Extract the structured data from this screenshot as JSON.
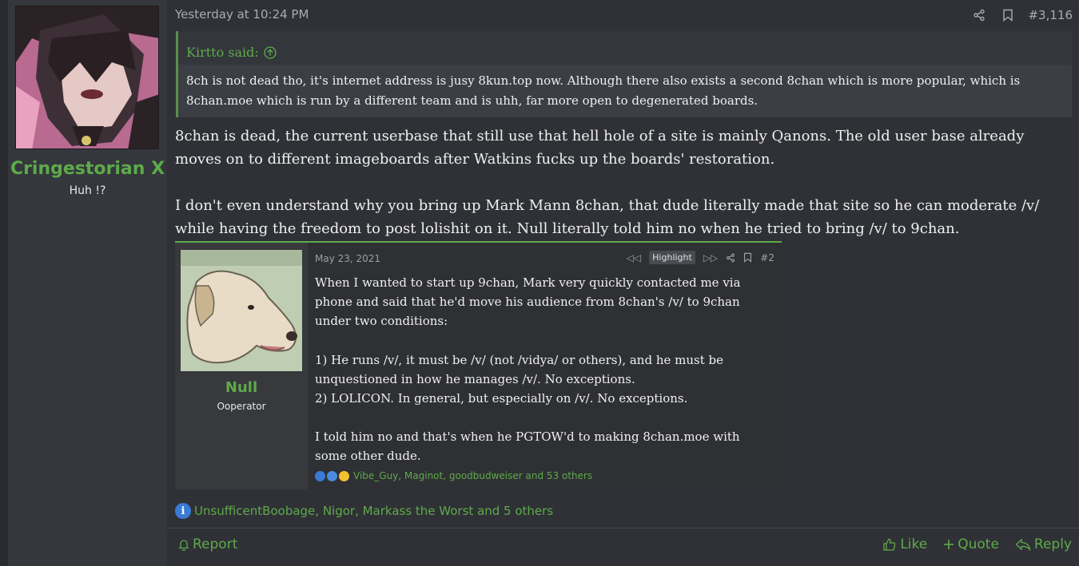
{
  "user": {
    "name": "Cringestorian X",
    "title": "Huh !?"
  },
  "post": {
    "date": "Yesterday at 10:24 PM",
    "number": "#3,116",
    "quote": {
      "author": "Kirtto said:",
      "text": "8ch is not dead tho, it's internet address is jusy 8kun.top now. Although there also exists a second 8chan which is more popular, which is 8chan.moe which is run by a different team and is uhh, far more open to degenerated boards."
    },
    "paragraphs": [
      "8chan is dead, the current userbase that still use that hell hole of a site is mainly Qanons. The old user base already moves on to different imageboards after Watkins fucks up the boards' restoration.",
      "I don't even understand why you bring up Mark Mann 8chan, that dude literally made that site so he can moderate /v/ while having the freedom to post lolishit on it. Null literally told him no when he tried to bring /v/ to 9chan."
    ],
    "reactions_text": "UnsufficentBoobage, Nigor, Markass the Worst and 5 others"
  },
  "embed": {
    "user_name": "Null",
    "user_title": "Ooperator",
    "date": "May 23, 2021",
    "highlight_label": "Highlight",
    "number": "#2",
    "paragraphs": [
      "When I wanted to start up 9chan, Mark very quickly contacted me via phone and said that he'd move his audience from 8chan's /v/ to 9chan under two conditions:",
      "1) He runs /v/, it must be /v/ (not /vidya/ or others), and he must be unquestioned in how he manages /v/. No exceptions.\n2) LOLICON. In general, but especially on /v/. No exceptions.",
      "I told him no and that's when he PGTOW'd to making 8chan.moe with some other dude."
    ],
    "reactions_text": "Vibe_Guy, Maginot, goodbudweiser and 53 others"
  },
  "footer": {
    "report_label": "Report",
    "like_label": "Like",
    "quote_label": "Quote",
    "reply_label": "Reply"
  },
  "icons": {
    "share": "share-icon",
    "bookmark": "bookmark-icon",
    "quote_arrow": "arrow-up-circle-icon",
    "info_reaction": "info-reaction-icon",
    "bell": "bell-icon",
    "thumbs_up": "thumbs-up-icon",
    "plus": "plus-icon",
    "reply": "reply-arrow-icon"
  },
  "colors": {
    "accent": "#5eaa4a",
    "background": "#2f3136",
    "sidebar": "#34373c"
  }
}
